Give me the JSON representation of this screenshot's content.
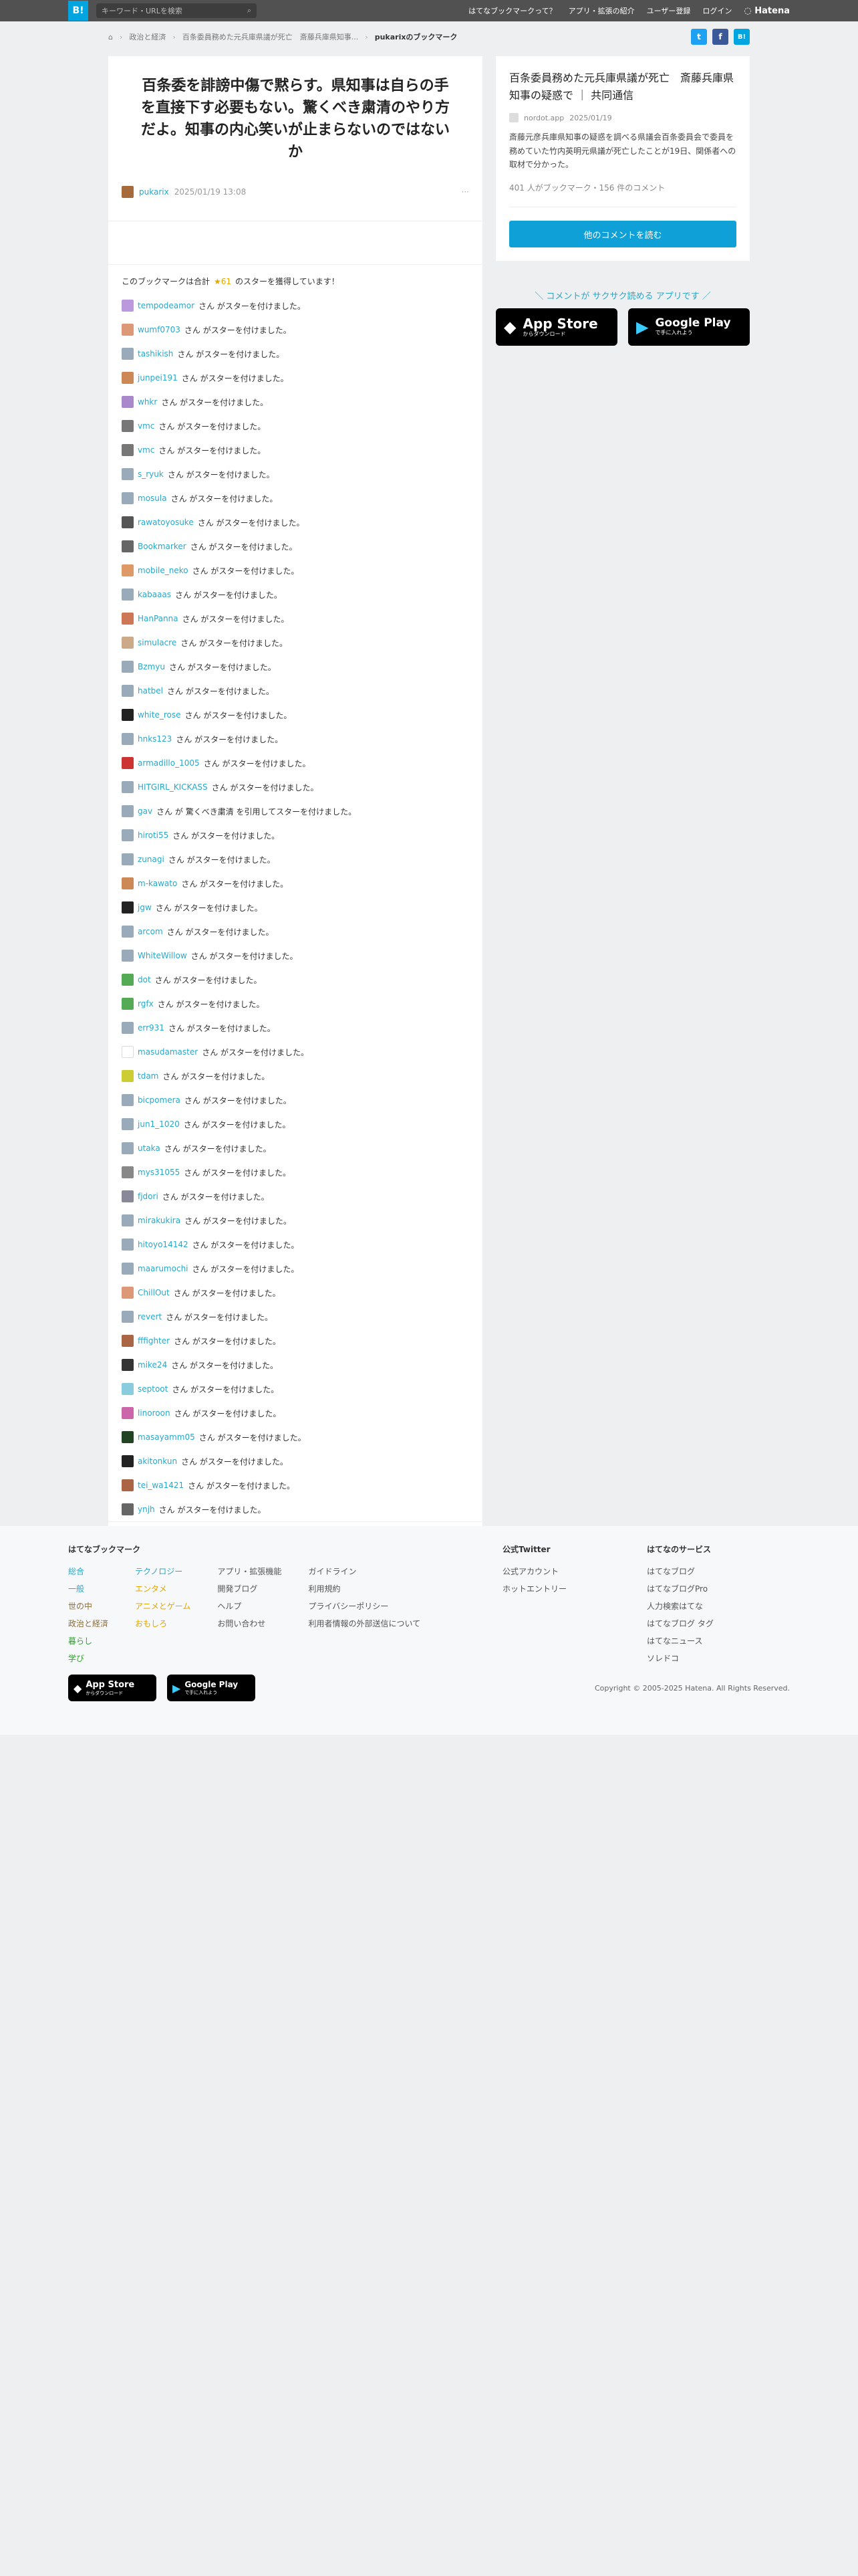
{
  "header": {
    "logo": "B!",
    "search_placeholder": "キーワード・URLを検索",
    "nav": [
      "はてなブックマークって？",
      "アプリ・拡張の紹介",
      "ユーザー登録",
      "ログイン"
    ],
    "brand": "Hatena"
  },
  "breadcrumb": {
    "items": [
      "政治と経済",
      "百条委員務めた元兵庫県議が死亡　斎藤兵庫県知事..."
    ],
    "current": "pukarixのブックマーク"
  },
  "share": {
    "twitter": "t",
    "facebook": "f",
    "hatena": "B!"
  },
  "comment": {
    "title": "百条委を誹謗中傷で黙らす。県知事は自らの手を直接下す必要もない。驚くべき粛清のやり方だよ。知事の内心笑いが止まらないのではないか",
    "user": "pukarix",
    "date": "2025/01/19 13:08",
    "more": "···"
  },
  "star_summary": {
    "prefix": "このブックマークは合計",
    "count": "★61",
    "suffix": "のスターを獲得しています！"
  },
  "star_suffix": "さん がスターを付けました。",
  "star_users": [
    {
      "name": "tempodeamor",
      "color": "#b9d"
    },
    {
      "name": "wumf0703",
      "color": "#d97"
    },
    {
      "name": "tashikish",
      "color": "#9ab"
    },
    {
      "name": "junpei191",
      "color": "#c85"
    },
    {
      "name": "whkr",
      "color": "#a8c"
    },
    {
      "name": "vmc",
      "color": "#777"
    },
    {
      "name": "vmc",
      "color": "#777"
    },
    {
      "name": "s_ryuk",
      "color": "#9ab"
    },
    {
      "name": "mosula",
      "color": "#9ab"
    },
    {
      "name": "rawatoyosuke",
      "color": "#555"
    },
    {
      "name": "Bookmarker",
      "color": "#666"
    },
    {
      "name": "mobile_neko",
      "color": "#d96"
    },
    {
      "name": "kabaaas",
      "color": "#9ab"
    },
    {
      "name": "HanPanna",
      "color": "#c75"
    },
    {
      "name": "simulacre",
      "color": "#ca8"
    },
    {
      "name": "Bzmyu",
      "color": "#9ab"
    },
    {
      "name": "hatbel",
      "color": "#9ab"
    },
    {
      "name": "white_rose",
      "color": "#222"
    },
    {
      "name": "hnks123",
      "color": "#9ab"
    },
    {
      "name": "armadillo_1005",
      "color": "#c33"
    },
    {
      "name": "HITGIRL_KICKASS",
      "color": "#9ab"
    },
    {
      "name": "gav",
      "color": "#9ab",
      "special": "さん が 驚くべき粛清 を引用してスターを付けました。"
    },
    {
      "name": "hiroti55",
      "color": "#9ab"
    },
    {
      "name": "zunagi",
      "color": "#9ab"
    },
    {
      "name": "m-kawato",
      "color": "#c85"
    },
    {
      "name": "jgw",
      "color": "#222"
    },
    {
      "name": "arcom",
      "color": "#9ab"
    },
    {
      "name": "WhiteWillow",
      "color": "#9ab"
    },
    {
      "name": "dot",
      "color": "#5a5"
    },
    {
      "name": "rgfx",
      "color": "#5a5"
    },
    {
      "name": "err931",
      "color": "#9ab"
    },
    {
      "name": "masudamaster",
      "color": "#fff"
    },
    {
      "name": "tdam",
      "color": "#cc3"
    },
    {
      "name": "bicpomera",
      "color": "#9ab"
    },
    {
      "name": "jun1_1020",
      "color": "#9ab"
    },
    {
      "name": "utaka",
      "color": "#9ab"
    },
    {
      "name": "mys31055",
      "color": "#888"
    },
    {
      "name": "fjdori",
      "color": "#889"
    },
    {
      "name": "mirakukira",
      "color": "#9ab"
    },
    {
      "name": "hitoyo14142",
      "color": "#9ab"
    },
    {
      "name": "maarumochi",
      "color": "#9ab"
    },
    {
      "name": "ChillOut",
      "color": "#d97"
    },
    {
      "name": "revert",
      "color": "#9ab"
    },
    {
      "name": "fffighter",
      "color": "#a64"
    },
    {
      "name": "mike24",
      "color": "#333"
    },
    {
      "name": "septoot",
      "color": "#8cd"
    },
    {
      "name": "linoroon",
      "color": "#c6a"
    },
    {
      "name": "masayamm05",
      "color": "#242"
    },
    {
      "name": "akitonkun",
      "color": "#222"
    },
    {
      "name": "tei_wa1421",
      "color": "#a64"
    },
    {
      "name": "ynjh",
      "color": "#666"
    }
  ],
  "entry": {
    "title": "百条委員務めた元兵庫県議が死亡　斎藤兵庫県知事の疑惑で ｜ 共同通信",
    "site": "nordot.app",
    "date": "2025/01/19",
    "desc": "斎藤元彦兵庫県知事の疑惑を調べる県議会百条委員会で委員を務めていた竹内英明元県議が死亡したことが19日、関係者への取材で分かった。",
    "stats": "401 人がブックマーク・156 件のコメント",
    "read_button": "他のコメントを読む"
  },
  "app_promo": {
    "hint": "＼ コメントが サクサク読める アプリです ／",
    "appstore": {
      "title": "App Store",
      "sub": "からダウンロード"
    },
    "googleplay": {
      "title": "Google Play",
      "sub": "で手に入れよう"
    }
  },
  "footer": {
    "about_title": "はてなブックマーク",
    "categories": [
      [
        "総合",
        "一般",
        "世の中",
        "政治と経済",
        "暮らし",
        "学び"
      ],
      [
        "テクノロジー",
        "エンタメ",
        "アニメとゲーム",
        "おもしろ"
      ]
    ],
    "links1": [
      "アプリ・拡張機能",
      "開発ブログ",
      "ヘルプ",
      "お問い合わせ"
    ],
    "links2": [
      "ガイドライン",
      "利用規約",
      "プライバシーポリシー",
      "利用者情報の外部送信について"
    ],
    "twitter_title": "公式Twitter",
    "twitter_links": [
      "公式アカウント",
      "ホットエントリー"
    ],
    "services_title": "はてなのサービス",
    "services": [
      "はてなブログ",
      "はてなブログPro",
      "人力検索はてな",
      "はてなブログ タグ",
      "はてなニュース",
      "ソレドコ"
    ],
    "copyright": "Copyright © 2005-2025 Hatena. All Rights Reserved."
  },
  "colors": {
    "accent": "#00a4de",
    "link": "#2aa7c7",
    "star": "#e0a800"
  }
}
